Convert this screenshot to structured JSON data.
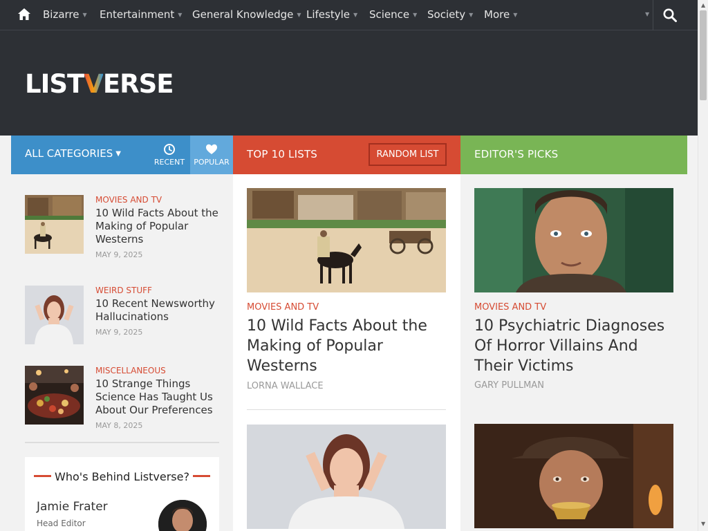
{
  "nav": {
    "items": [
      {
        "label": "Bizarre"
      },
      {
        "label": "Entertainment"
      },
      {
        "label": "General Knowledge"
      },
      {
        "label": "Lifestyle"
      },
      {
        "label": "Science"
      },
      {
        "label": "Society"
      },
      {
        "label": "More"
      }
    ],
    "caret": "▼"
  },
  "header": {
    "logo_left": "LIST",
    "logo_v": "V",
    "logo_right": "ERSE"
  },
  "columns": {
    "categories": {
      "label": "ALL CATEGORIES",
      "triangle": "▼",
      "tab_recent": "RECENT",
      "tab_popular": "POPULAR"
    },
    "top10": {
      "title": "TOP 10 LISTS",
      "random_button": "RANDOM LIST"
    },
    "picks": {
      "title": "EDITOR'S PICKS"
    }
  },
  "sidebar": {
    "items": [
      {
        "category": "MOVIES AND TV",
        "title": "10 Wild Facts About the Making of Popular Westerns",
        "date": "MAY 9, 2025"
      },
      {
        "category": "WEIRD STUFF",
        "title": "10 Recent Newsworthy Hallucinations",
        "date": "MAY 9, 2025"
      },
      {
        "category": "MISCELLANEOUS",
        "title": "10 Strange Things Science Has Taught Us About Our Preferences",
        "date": "MAY 8, 2025"
      }
    ],
    "who": {
      "title": "Who's Behind Listverse?",
      "name": "Jamie Frater",
      "role": "Head Editor"
    }
  },
  "top10_articles": [
    {
      "category": "MOVIES AND TV",
      "title": "10 Wild Facts About the Making of Popular Westerns",
      "author": "LORNA WALLACE"
    }
  ],
  "picks_articles": [
    {
      "category": "MOVIES AND TV",
      "title": "10 Psychiatric Diagnoses Of Horror Villains And Their Victims",
      "author": "GARY PULLMAN"
    }
  ],
  "colors": {
    "nav_bg": "#2d3035",
    "categories_blue": "#3d8fc9",
    "top10_red": "#d64b33",
    "picks_green": "#79b555",
    "accent_red": "#d64b33"
  },
  "icons": {
    "home": "home-icon",
    "search": "search-icon",
    "recent": "clock-icon",
    "popular": "heart-icon"
  }
}
